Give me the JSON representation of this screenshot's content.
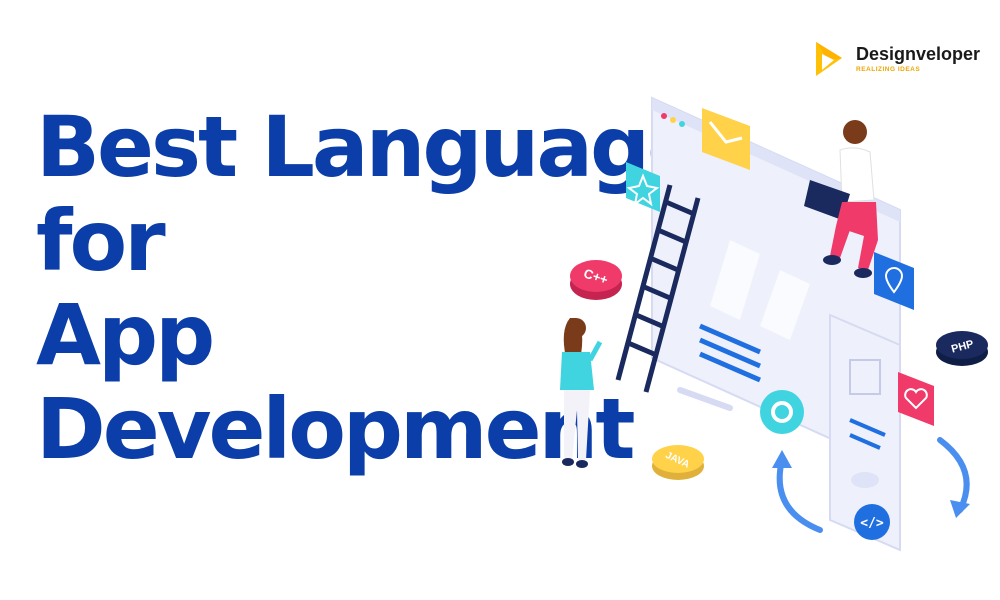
{
  "title": {
    "lines": [
      "Best Languages",
      "for",
      "App",
      "Development"
    ],
    "color": "#0b3ea8"
  },
  "brand": {
    "name_part1": "Design",
    "name_part2": "veloper",
    "tagline": "REALIZING IDEAS",
    "logo_color": "#ffc107",
    "tagline_color": "#f0a500"
  },
  "badges": {
    "cpp": "C++",
    "php": "PHP",
    "java": "JAVA"
  },
  "colors": {
    "primary_blue": "#1f6fe0",
    "panel": "#eef0fb",
    "ladder": "#1a2a5e",
    "pink": "#ef3a6a",
    "yellow": "#ffd24a",
    "cyan": "#3fd4e0"
  },
  "icons": [
    "email-icon",
    "star-icon",
    "location-pin-icon",
    "heart-icon",
    "gear-icon",
    "code-icon",
    "image-icon",
    "sync-arrows-icon"
  ]
}
